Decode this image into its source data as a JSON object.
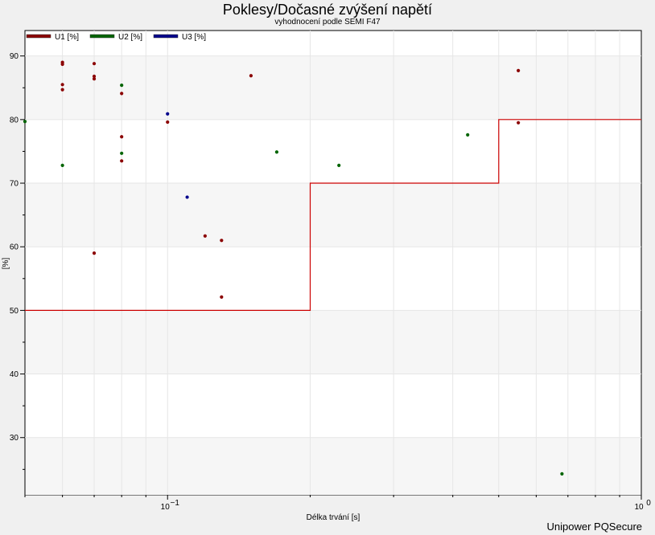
{
  "chart_data": {
    "type": "scatter",
    "title": "Poklesy/Dočasné zvýšení napětí",
    "subtitle": "vyhodnocení podle SEMI F47",
    "xlabel": "Délka trvání [s]",
    "ylabel": "[%]",
    "x_scale": "log",
    "xlim": [
      0.05,
      1.0
    ],
    "ylim": [
      21,
      94
    ],
    "x_tick_labels": [
      {
        "value": 0.1,
        "base": "10",
        "exp": "−1"
      },
      {
        "value": 1.0,
        "base": "10",
        "exp": "0"
      }
    ],
    "y_ticks": [
      30,
      40,
      50,
      60,
      70,
      80,
      90
    ],
    "legend_placement": "top-left",
    "grid": true,
    "series": [
      {
        "name": "U1 [%]",
        "color": "#8b0000",
        "points": [
          [
            0.06,
            89.0
          ],
          [
            0.06,
            88.7
          ],
          [
            0.06,
            85.5
          ],
          [
            0.06,
            84.7
          ],
          [
            0.07,
            88.8
          ],
          [
            0.07,
            86.8
          ],
          [
            0.07,
            86.4
          ],
          [
            0.07,
            59.0
          ],
          [
            0.08,
            84.1
          ],
          [
            0.08,
            77.3
          ],
          [
            0.08,
            73.5
          ],
          [
            0.1,
            79.6
          ],
          [
            0.12,
            61.7
          ],
          [
            0.13,
            61.0
          ],
          [
            0.13,
            52.1
          ],
          [
            0.15,
            86.9
          ],
          [
            0.55,
            87.7
          ],
          [
            0.55,
            79.5
          ]
        ]
      },
      {
        "name": "U2 [%]",
        "color": "#006400",
        "points": [
          [
            0.05,
            79.7
          ],
          [
            0.06,
            72.8
          ],
          [
            0.08,
            85.4
          ],
          [
            0.08,
            74.7
          ],
          [
            0.17,
            74.9
          ],
          [
            0.23,
            72.8
          ],
          [
            0.43,
            77.6
          ],
          [
            0.68,
            24.3
          ]
        ]
      },
      {
        "name": "U3 [%]",
        "color": "#00008b",
        "points": [
          [
            0.1,
            80.9
          ],
          [
            0.11,
            67.8
          ]
        ]
      }
    ],
    "limit_curve": {
      "color": "#cc0000",
      "points": [
        [
          0.05,
          50
        ],
        [
          0.2,
          50
        ],
        [
          0.2,
          70
        ],
        [
          0.5,
          70
        ],
        [
          0.5,
          80
        ],
        [
          1.0,
          80
        ]
      ]
    }
  },
  "footer": "Unipower PQSecure"
}
